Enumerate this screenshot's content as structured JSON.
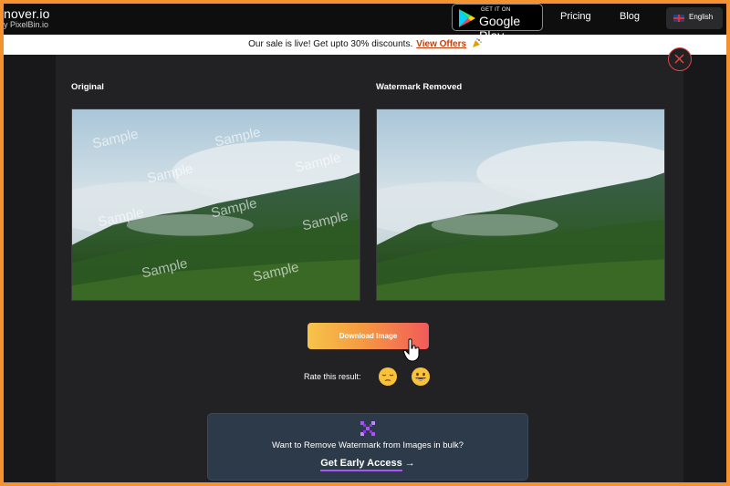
{
  "brand": {
    "name": "nover.io",
    "sub": "y PixelBin.io"
  },
  "nav": {
    "play_small": "GET IT ON",
    "play_big": "Google Play",
    "pricing": "Pricing",
    "blog": "Blog",
    "language": "English"
  },
  "promo": {
    "text": "Our sale is live! Get upto 30% discounts.",
    "link": "View Offers"
  },
  "result": {
    "original_label": "Original",
    "removed_label": "Watermark Removed",
    "watermark_text": "Sample",
    "download_label": "Download Image",
    "rate_label": "Rate this result:"
  },
  "bulk": {
    "text": "Want to Remove Watermark from Images in bulk?",
    "cta": "Get Early Access",
    "arrow": "→"
  },
  "colors": {
    "accent_orange": "#f5912f",
    "gradient_start": "#f7c44a",
    "gradient_end": "#f25a5a",
    "close_red": "#e04545",
    "bulk_bg": "#2c3a4a",
    "purple": "#a855f7"
  },
  "icons": [
    "google-play-icon",
    "uk-flag-icon",
    "party-popper-icon",
    "close-icon",
    "pointer-hand-cursor",
    "pensive-emoji-icon",
    "grinning-emoji-icon",
    "bulk-process-icon",
    "arrow-right-icon"
  ]
}
